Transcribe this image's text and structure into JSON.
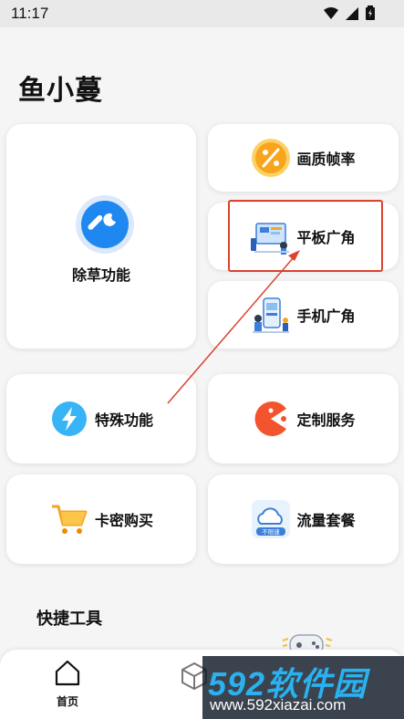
{
  "status_bar": {
    "time": "11:17"
  },
  "app": {
    "title": "鱼小蔓"
  },
  "features": {
    "weed": {
      "label": "除草功能",
      "icon": "wrench-icon"
    },
    "quality": {
      "label": "画质帧率",
      "icon": "percent-icon"
    },
    "tablet": {
      "label": "平板广角",
      "icon": "tablet-illustration-icon"
    },
    "phone": {
      "label": "手机广角",
      "icon": "phone-illustration-icon"
    },
    "special": {
      "label": "特殊功能",
      "icon": "lightning-icon"
    },
    "custom": {
      "label": "定制服务",
      "icon": "pacman-icon"
    },
    "card": {
      "label": "卡密购买",
      "icon": "shopping-cart-icon"
    },
    "traffic": {
      "label": "流量套餐",
      "icon": "cloud-icon",
      "badge": "不限速"
    }
  },
  "quick_tools": {
    "title": "快捷工具"
  },
  "bottom_nav": {
    "home_label": "首页"
  },
  "watermark": {
    "title": "592软件园",
    "url": "www.592xiazai.com"
  },
  "colors": {
    "accent_blue": "#1e88f0",
    "highlight_red": "#d9432f",
    "watermark_blue": "#2ab2f0"
  }
}
